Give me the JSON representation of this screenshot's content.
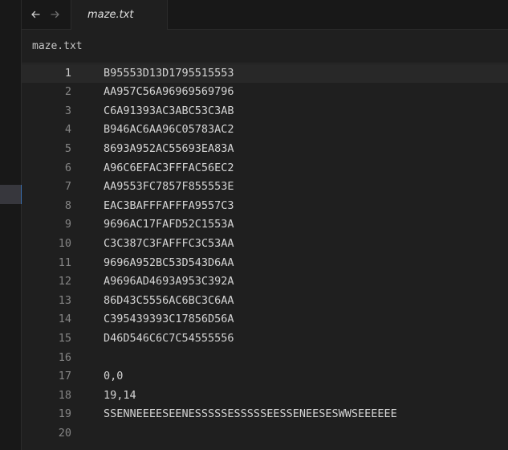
{
  "tab": {
    "label": "maze.txt"
  },
  "breadcrumb": {
    "label": "maze.txt"
  },
  "editor": {
    "current_line": 1,
    "lines": [
      {
        "num": "1",
        "text": "B95553D13D1795515553"
      },
      {
        "num": "2",
        "text": "AA957C56A96969569796"
      },
      {
        "num": "3",
        "text": "C6A91393AC3ABC53C3AB"
      },
      {
        "num": "4",
        "text": "B946AC6AA96C05783AC2"
      },
      {
        "num": "5",
        "text": "8693A952AC55693EA83A"
      },
      {
        "num": "6",
        "text": "A96C6EFAC3FFFAC56EC2"
      },
      {
        "num": "7",
        "text": "AA9553FC7857F855553E"
      },
      {
        "num": "8",
        "text": "EAC3BAFFFAFFFA9557C3"
      },
      {
        "num": "9",
        "text": "9696AC17FAFD52C1553A"
      },
      {
        "num": "10",
        "text": "C3C387C3FAFFFC3C53AA"
      },
      {
        "num": "11",
        "text": "9696A952BC53D543D6AA"
      },
      {
        "num": "12",
        "text": "A9696AD4693A953C392A"
      },
      {
        "num": "13",
        "text": "86D43C5556AC6BC3C6AA"
      },
      {
        "num": "14",
        "text": "C395439393C17856D56A"
      },
      {
        "num": "15",
        "text": "D46D546C6C7C54555556"
      },
      {
        "num": "16",
        "text": ""
      },
      {
        "num": "17",
        "text": "0,0"
      },
      {
        "num": "18",
        "text": "19,14"
      },
      {
        "num": "19",
        "text": "SSENNEEEESEENESSSSSESSSSSEESSENEESESWWSEEEEEE"
      },
      {
        "num": "20",
        "text": ""
      }
    ]
  },
  "icons": {
    "back": "arrow-left-icon",
    "forward": "arrow-right-icon"
  },
  "colors": {
    "editor_bg": "#1f1f1f",
    "chrome_bg": "#181818",
    "text": "#d4d4d4",
    "line_number": "#858585",
    "current_line_bg": "#282828",
    "selection_accent": "#3a6fb0"
  }
}
